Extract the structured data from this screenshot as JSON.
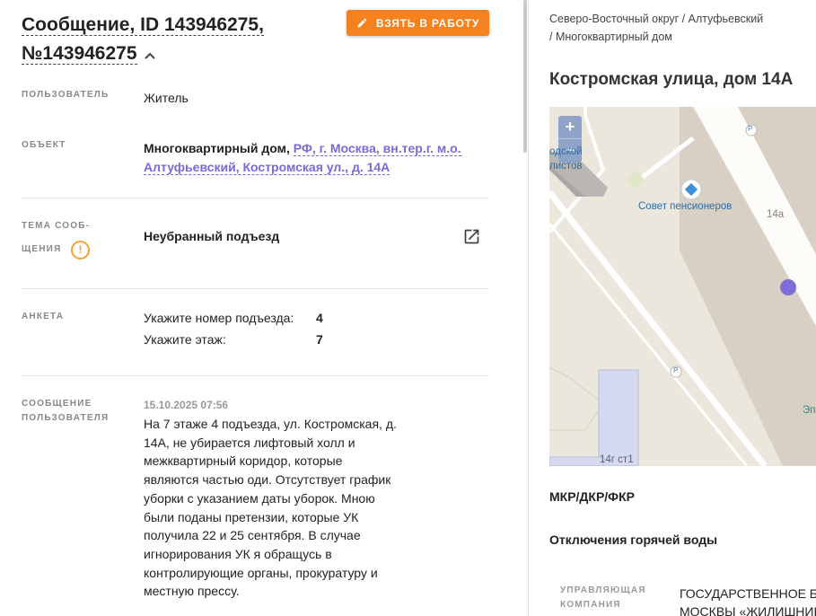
{
  "header": {
    "title": "Сообщение, ID 143946275, №143946275",
    "take_button": "ВЗЯТЬ В РАБОТУ"
  },
  "fields": {
    "user_label": "ПОЛЬЗОВАТЕЛЬ",
    "user_value": "Житель",
    "object_label": "ОБЪЕКТ",
    "object_type": "Многоквартирный дом,",
    "object_link_line1": "РФ, г. Москва, вн.тер.г. м.о.",
    "object_link_line2": "Алтуфьевский, Костромская ул., д. 14А",
    "topic_label_line1": "ТЕМА СООБ-",
    "topic_label_line2": "ЩЕНИЯ",
    "topic_value": "Неубранный подъезд",
    "warn_glyph": "!",
    "survey_label": "АНКЕТА",
    "survey": [
      {
        "question": "Укажите номер подъезда:",
        "answer": "4"
      },
      {
        "question": "Укажите этаж:",
        "answer": "7"
      }
    ],
    "message_label_line1": "СООБЩЕНИЕ",
    "message_label_line2": "ПОЛЬЗОВАТЕЛЯ",
    "message_date": "15.10.2025 07:56",
    "message_lines": [
      "На 7 этаже 4 подъезда, ул. Костромская, д.",
      "14А, не убирается лифтовый холл и",
      "межквартирный коридор, которые",
      "являются частью оди. Отсутствует график",
      "уборки с указанием даты уборок. Мною",
      "были поданы претензии, которые УК",
      "получила 22 и 25 сентября. В случае",
      "игнорирования УК я обращусь в",
      "контролирующие органы, прокуратуру и",
      "местную прессу."
    ]
  },
  "right": {
    "breadcrumb_line1": "Северо-Восточный округ / Алтуфьевский",
    "breadcrumb_line2": "/ Многоквартирный дом",
    "address": "Костромская улица, дом 14А",
    "map": {
      "zoom_in": "+",
      "zoom_out": "−",
      "label_poi": "Совет пенсионеров",
      "label_left1": "одской",
      "label_left2": "листов",
      "label_house": "14а",
      "label_building": "14г ст1",
      "label_edge": "Эп",
      "parking": "P"
    },
    "section_1": "МКР/ДКР/ФКР",
    "section_2": "Отключения горячей воды",
    "mgmt_label_line1": "УПРАВЛЯЮЩАЯ",
    "mgmt_label_line2": "КОМПАНИЯ",
    "mgmt_value_line1": "ГОСУДАРСТВЕННОЕ БЮ",
    "mgmt_value_line2": "МОСКВЫ «ЖИЛИШНИК"
  },
  "colors": {
    "accent": "#f5811f",
    "link": "#7a6ad8",
    "warn": "#f5a130"
  }
}
